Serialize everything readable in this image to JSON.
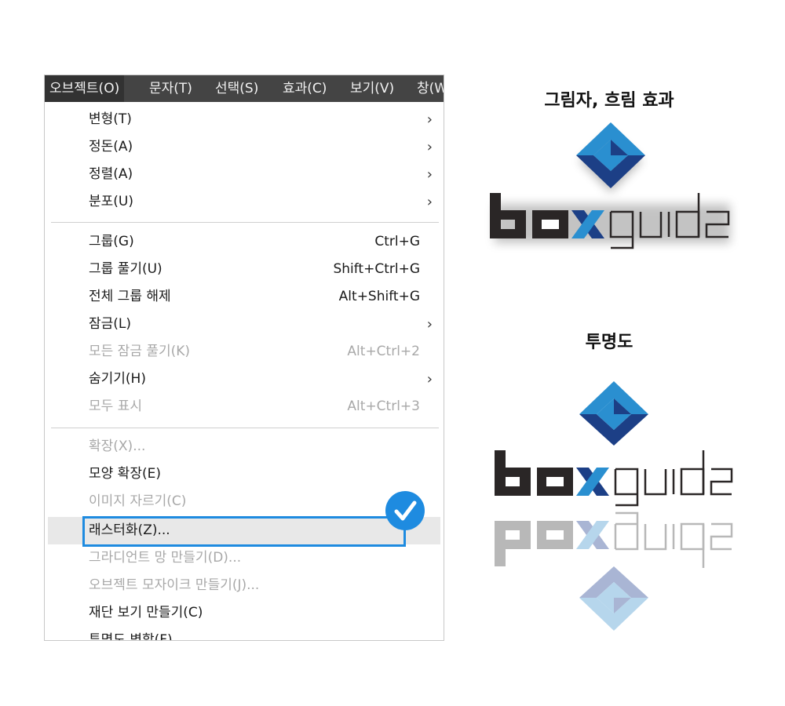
{
  "menubar": {
    "items": [
      {
        "label": "오브젝트(O)",
        "active": true
      },
      {
        "label": "문자(T)",
        "active": false
      },
      {
        "label": "선택(S)",
        "active": false
      },
      {
        "label": "효과(C)",
        "active": false
      },
      {
        "label": "보기(V)",
        "active": false
      },
      {
        "label": "창(W",
        "active": false
      }
    ]
  },
  "menu": {
    "items": [
      {
        "label": "변형(T)",
        "shortcut": "",
        "submenu": true,
        "disabled": false
      },
      {
        "label": "정돈(A)",
        "shortcut": "",
        "submenu": true,
        "disabled": false
      },
      {
        "label": "정렬(A)",
        "shortcut": "",
        "submenu": true,
        "disabled": false
      },
      {
        "label": "분포(U)",
        "shortcut": "",
        "submenu": true,
        "disabled": false
      },
      {
        "label": "그룹(G)",
        "shortcut": "Ctrl+G",
        "submenu": false,
        "disabled": false
      },
      {
        "label": "그룹 풀기(U)",
        "shortcut": "Shift+Ctrl+G",
        "submenu": false,
        "disabled": false
      },
      {
        "label": "전체 그룹 해제",
        "shortcut": "Alt+Shift+G",
        "submenu": false,
        "disabled": false
      },
      {
        "label": "잠금(L)",
        "shortcut": "",
        "submenu": true,
        "disabled": false
      },
      {
        "label": "모든 잠금 풀기(K)",
        "shortcut": "Alt+Ctrl+2",
        "submenu": false,
        "disabled": true
      },
      {
        "label": "숨기기(H)",
        "shortcut": "",
        "submenu": true,
        "disabled": false
      },
      {
        "label": "모두 표시",
        "shortcut": "Alt+Ctrl+3",
        "submenu": false,
        "disabled": true
      },
      {
        "label": "확장(X)...",
        "shortcut": "",
        "submenu": false,
        "disabled": true
      },
      {
        "label": "모양 확장(E)",
        "shortcut": "",
        "submenu": false,
        "disabled": false
      },
      {
        "label": "이미지 자르기(C)",
        "shortcut": "",
        "submenu": false,
        "disabled": true
      },
      {
        "label": "래스터화(Z)...",
        "shortcut": "",
        "submenu": false,
        "disabled": false
      },
      {
        "label": "그라디언트 망 만들기(D)...",
        "shortcut": "",
        "submenu": false,
        "disabled": true
      },
      {
        "label": "오브젝트 모자이크 만들기(J)...",
        "shortcut": "",
        "submenu": false,
        "disabled": true
      },
      {
        "label": "재단 보기 만들기(C)",
        "shortcut": "",
        "submenu": false,
        "disabled": false
      },
      {
        "label": "투명도 병합(F)",
        "shortcut": "",
        "submenu": false,
        "disabled": false
      }
    ],
    "submenu_arrow": "›"
  },
  "right_panel": {
    "section1_title": "그림자, 흐림 효과",
    "section2_title": "투명도",
    "logo_text": {
      "box": "box",
      "guide": "guide"
    }
  },
  "colors": {
    "menubar_bg": "#444444",
    "highlight": "#1e8be0",
    "logo_dark": "#2a2626",
    "logo_blue_dark": "#1c3f86",
    "logo_blue_light": "#2a8fd0",
    "logo_gray": "#b8b8b8",
    "logo_blue_faded": "#a9b5d4",
    "logo_lightblue_faded": "#b6d6ec"
  },
  "icons": [
    "chevron-right-icon",
    "checkmark-icon",
    "cube-logo-icon"
  ]
}
